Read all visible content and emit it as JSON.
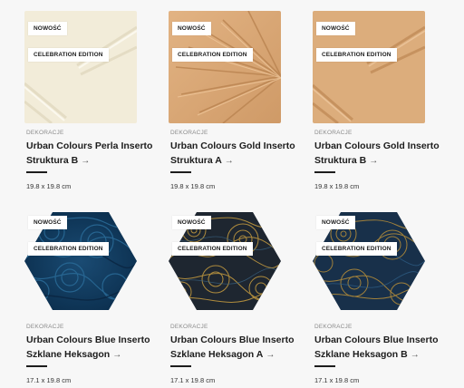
{
  "products": [
    {
      "badge_new": "NOWOŚĆ",
      "badge_edition": "CELEBRATION EDITION",
      "category": "DEKORACJE",
      "title_line1": "Urban Colours Perla Inserto",
      "title_line2": "Struktura B",
      "arrow": "→",
      "size": "19.8 x 19.8 cm",
      "tile_shape": "square",
      "tile_color": "#f2ecd9",
      "tile_pattern": "perla-struktura-b"
    },
    {
      "badge_new": "NOWOŚĆ",
      "badge_edition": "CELEBRATION EDITION",
      "category": "DEKORACJE",
      "title_line1": "Urban Colours Gold Inserto",
      "title_line2": "Struktura A",
      "arrow": "→",
      "size": "19.8 x 19.8 cm",
      "tile_shape": "square",
      "tile_color": "#d9a877",
      "tile_pattern": "gold-struktura-a"
    },
    {
      "badge_new": "NOWOŚĆ",
      "badge_edition": "CELEBRATION EDITION",
      "category": "DEKORACJE",
      "title_line1": "Urban Colours Gold Inserto",
      "title_line2": "Struktura B",
      "arrow": "→",
      "size": "19.8 x 19.8 cm",
      "tile_shape": "square",
      "tile_color": "#dcad7c",
      "tile_pattern": "gold-struktura-b"
    },
    {
      "badge_new": "NOWOŚĆ",
      "badge_edition": "CELEBRATION EDITION",
      "category": "DEKORACJE",
      "title_line1": "Urban Colours Blue Inserto",
      "title_line2": "Szklane Heksagon",
      "arrow": "→",
      "size": "17.1 x 19.8 cm",
      "tile_shape": "hexagon",
      "tile_color": "#0f3a5e",
      "tile_pattern": "blue-paisley"
    },
    {
      "badge_new": "NOWOŚĆ",
      "badge_edition": "CELEBRATION EDITION",
      "category": "DEKORACJE",
      "title_line1": "Urban Colours Blue Inserto",
      "title_line2": "Szklane Heksagon A",
      "arrow": "→",
      "size": "17.1 x 19.8 cm",
      "tile_shape": "hexagon",
      "tile_color": "#1e2630",
      "tile_pattern": "gold-paisley"
    },
    {
      "badge_new": "NOWOŚĆ",
      "badge_edition": "CELEBRATION EDITION",
      "category": "DEKORACJE",
      "title_line1": "Urban Colours Blue Inserto",
      "title_line2": "Szklane Heksagon B",
      "arrow": "→",
      "size": "17.1 x 19.8 cm",
      "tile_shape": "hexagon",
      "tile_color": "#18304a",
      "tile_pattern": "gold-paisley-b"
    }
  ]
}
